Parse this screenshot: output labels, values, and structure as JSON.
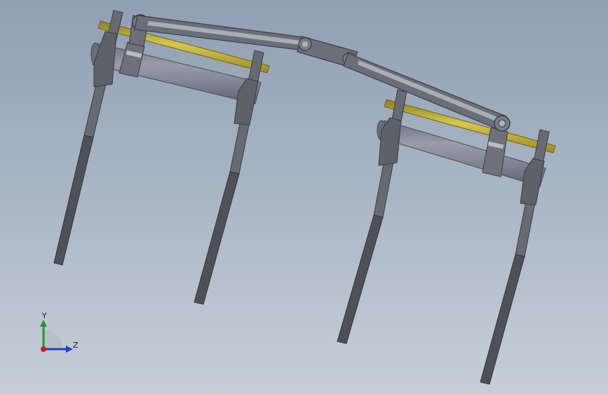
{
  "viewport": {
    "background_top": "#8fa0b2",
    "background_bottom": "#c7ced8"
  },
  "model": {
    "part_color_frame": "#5a5d66",
    "part_color_frame_dark": "#3c3e45",
    "part_color_frame_light": "#7a7e88",
    "part_color_roller": "#8a8c9c",
    "part_color_shaft": "#c8b43a",
    "part_color_link": "#6a6e78"
  },
  "triad": {
    "y_label": "Y",
    "z_label": "Z",
    "y_color": "#1f9a2a",
    "z_color": "#1f3fc8",
    "origin_color": "#c81f1f"
  }
}
